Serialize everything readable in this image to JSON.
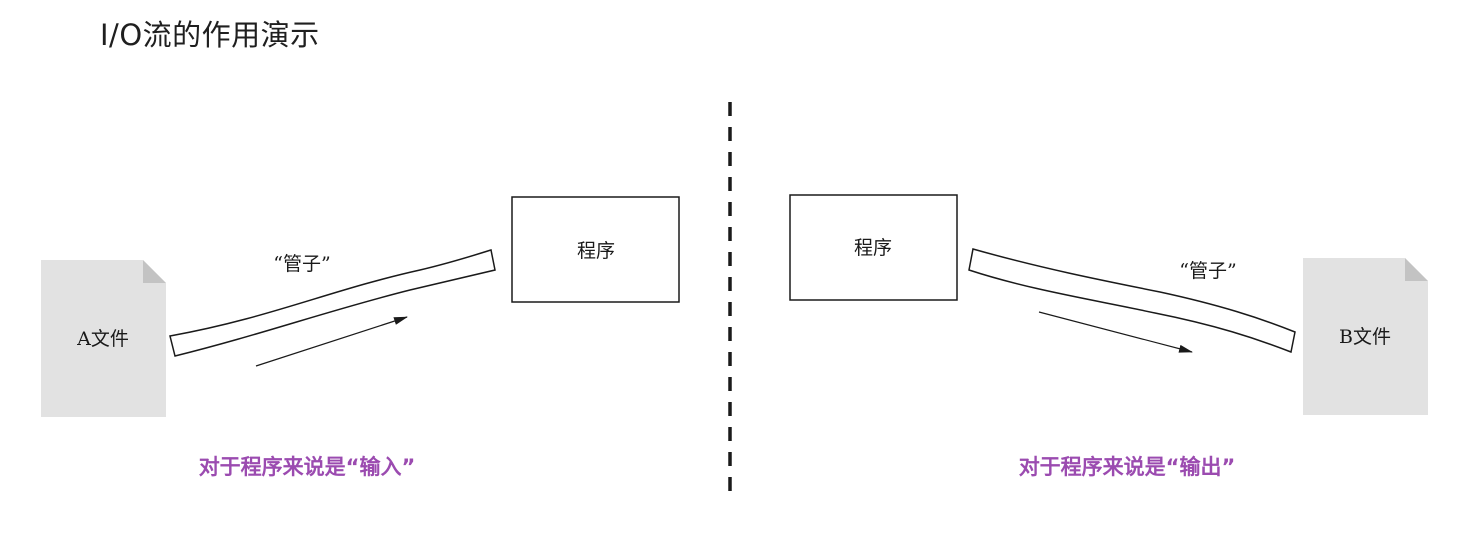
{
  "page": {
    "title": "I/O流的作用演示"
  },
  "left_panel": {
    "file_label": "A文件",
    "pipe_label": "“管子”",
    "program_label": "程序",
    "caption": "对于程序来说是“输入”"
  },
  "right_panel": {
    "file_label": "B文件",
    "pipe_label": "“管子”",
    "program_label": "程序",
    "caption": "对于程序来说是“输出”"
  },
  "colors": {
    "caption": "#9b4bb0",
    "file_fill": "#e2e2e2",
    "file_fold": "#c3c3c3",
    "stroke": "#1a1a1a",
    "divider": "#1a1a1a"
  }
}
